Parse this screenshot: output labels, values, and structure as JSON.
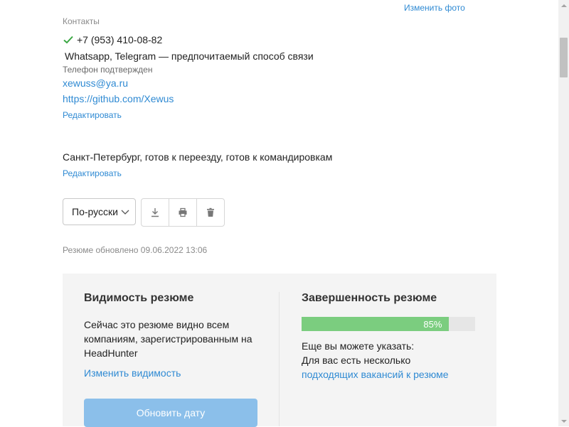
{
  "header": {
    "change_photo": "Изменить фото"
  },
  "contacts": {
    "heading": "Контакты",
    "phone": "+7 (953) 410-08-82",
    "preference": "Whatsapp, Telegram — предпочитаемый способ связи",
    "phone_status": "Телефон подтвержден",
    "email": "xewuss@ya.ru",
    "github": "https://github.com/Xewus",
    "edit": "Редактировать"
  },
  "location": {
    "text": "Санкт-Петербург, готов к переезду, готов к командировкам",
    "edit": "Редактировать"
  },
  "toolbar": {
    "language": "По-русски",
    "icons": [
      "download-icon",
      "print-icon",
      "trash-icon"
    ]
  },
  "updated": "Резюме обновлено 09.06.2022 13:06",
  "visibility": {
    "title": "Видимость резюме",
    "description": "Сейчас это резюме видно всем компаниям, зарегистрированным на HeadHunter",
    "change_link": "Изменить видимость",
    "update_button": "Обновить дату"
  },
  "completeness": {
    "title": "Завершенность резюме",
    "percent": 85,
    "percent_label": "85%",
    "also": "Еще вы можете указать:",
    "several": "Для вас есть несколько",
    "vacancies_link": "подходящих вакансий к резюме"
  },
  "colors": {
    "link": "#2f8ad3",
    "progress": "#7bcd7f",
    "button": "#8bbfea",
    "check": "#3aa742"
  }
}
